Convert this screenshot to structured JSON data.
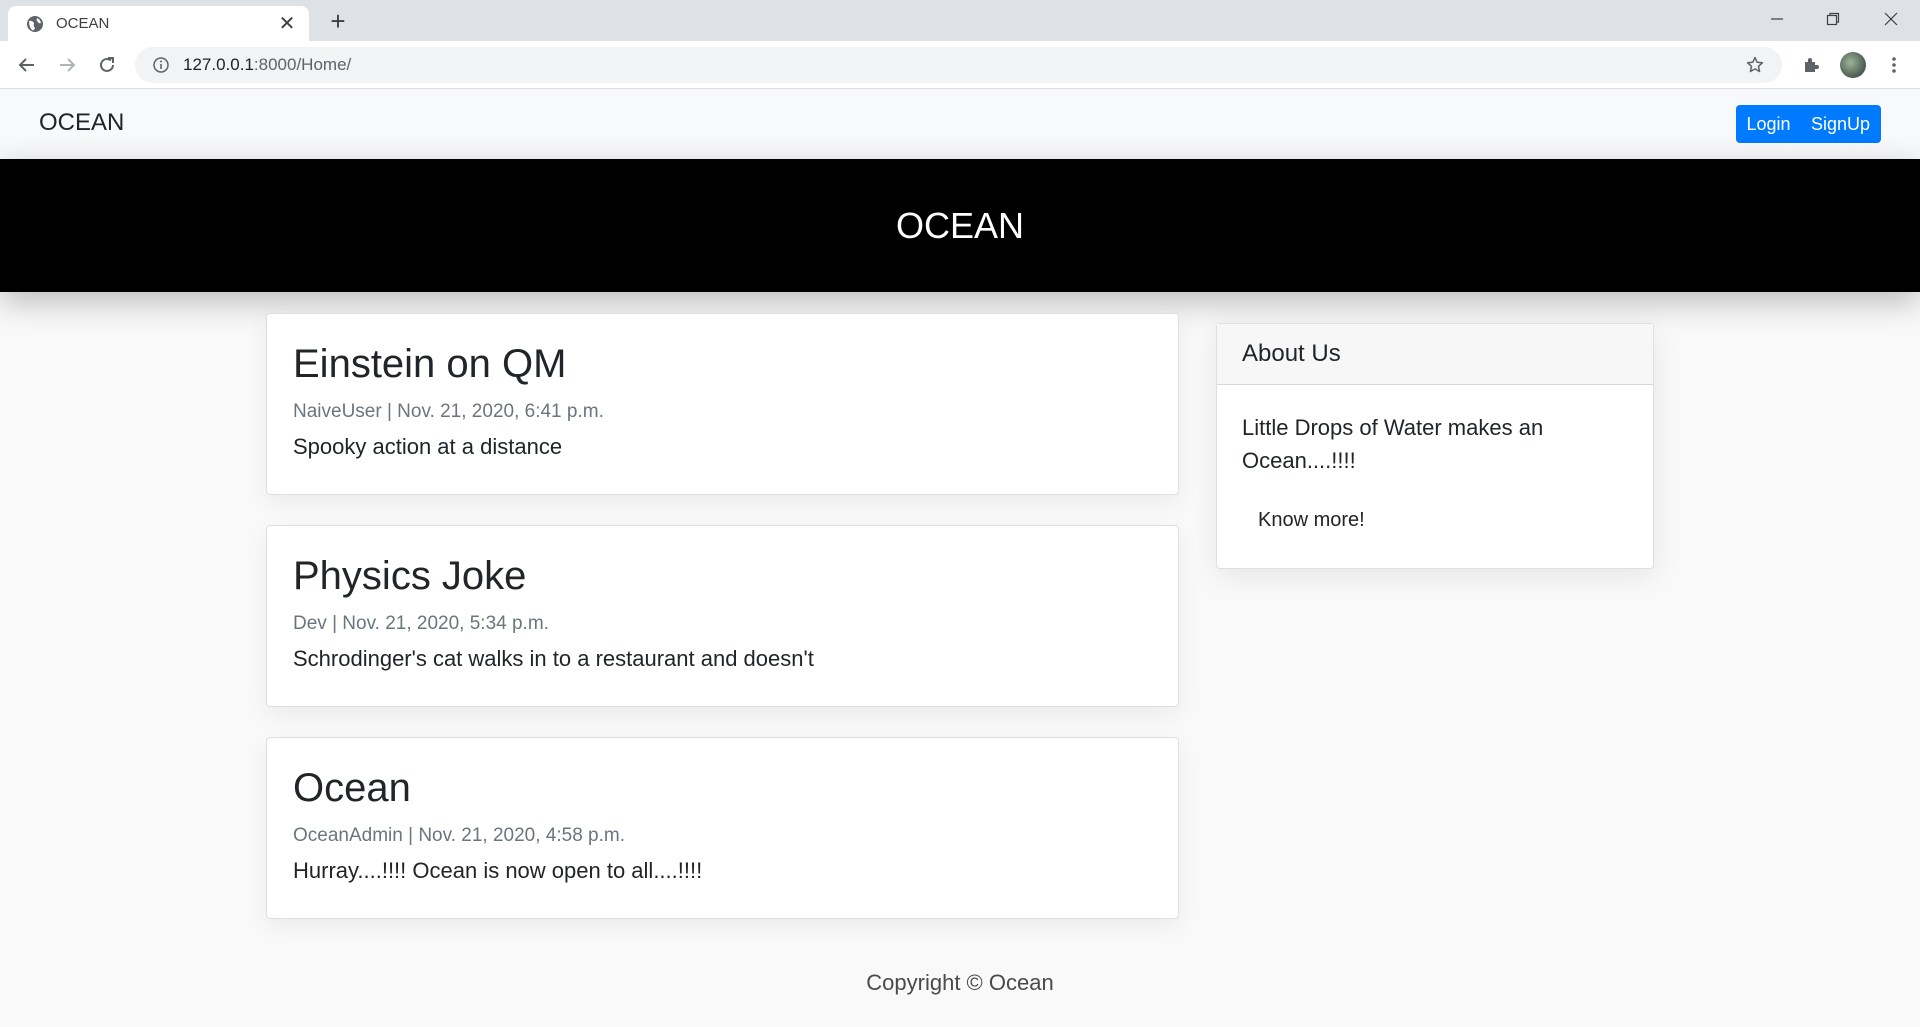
{
  "browser": {
    "tab_title": "OCEAN",
    "tab_close": "✕",
    "new_tab": "+",
    "url_host": "127.0.0.1",
    "url_rest": ":8000/Home/"
  },
  "navbar": {
    "brand": "OCEAN",
    "login_label": "Login",
    "signup_label": "SignUp"
  },
  "banner": {
    "title": "OCEAN"
  },
  "posts": [
    {
      "title": "Einstein on QM",
      "meta": "NaiveUser | Nov. 21, 2020, 6:41 p.m.",
      "body": "Spooky action at a distance"
    },
    {
      "title": "Physics Joke",
      "meta": "Dev | Nov. 21, 2020, 5:34 p.m.",
      "body": "Schrodinger's cat walks in to a restaurant and doesn't"
    },
    {
      "title": "Ocean",
      "meta": "OceanAdmin | Nov. 21, 2020, 4:58 p.m.",
      "body": "Hurray....!!!! Ocean is now open to all....!!!!"
    }
  ],
  "about": {
    "header": "About Us",
    "text": "Little Drops of Water makes an Ocean....!!!!",
    "link": "Know more!"
  },
  "footer": {
    "text": "Copyright © Ocean"
  },
  "colors": {
    "primary": "#007bff",
    "banner_bg": "#000000",
    "navbar_bg": "#f8f9fa",
    "page_bg": "#f9f9f9"
  }
}
